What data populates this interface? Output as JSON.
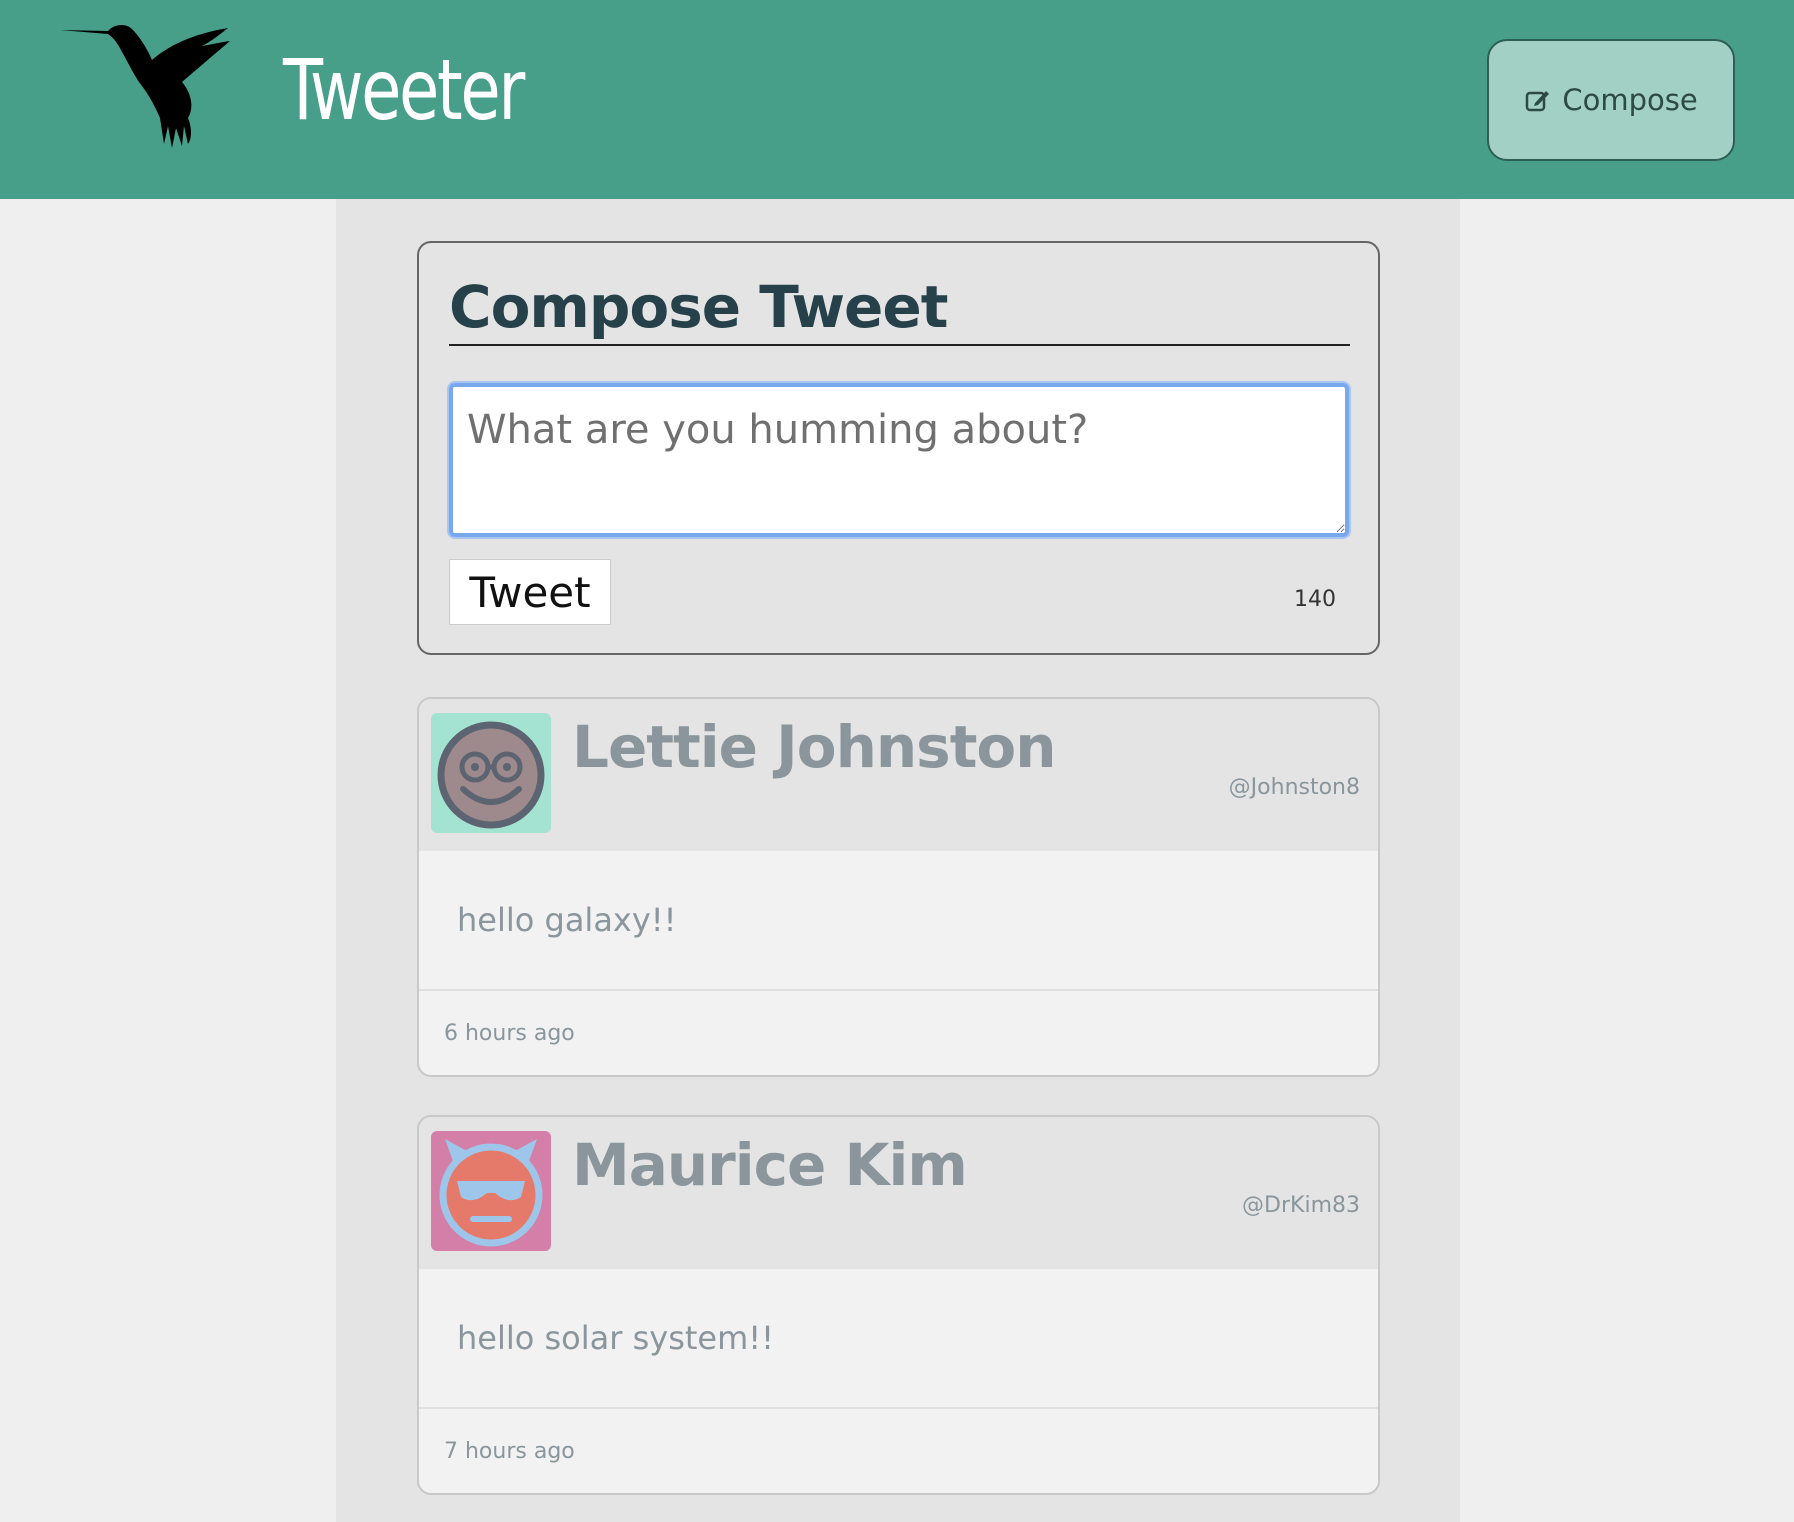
{
  "header": {
    "brand": "Tweeter",
    "compose_label": "Compose",
    "bg_color": "#479f8a"
  },
  "compose": {
    "title": "Compose Tweet",
    "placeholder": "What are you humming about?",
    "submit_label": "Tweet",
    "char_counter": "140"
  },
  "tweets": [
    {
      "author": "Lettie Johnston",
      "handle": "@Johnston8",
      "text": "hello galaxy!!",
      "timestamp": "6 hours ago",
      "avatar_icon": "nerd-smiley-avatar-icon",
      "avatar_bg": "#a4e2d2"
    },
    {
      "author": "Maurice Kim",
      "handle": "@DrKim83",
      "text": "hello solar system!!",
      "timestamp": "7 hours ago",
      "avatar_icon": "cool-devil-avatar-icon",
      "avatar_bg": "#d47fa8"
    }
  ]
}
